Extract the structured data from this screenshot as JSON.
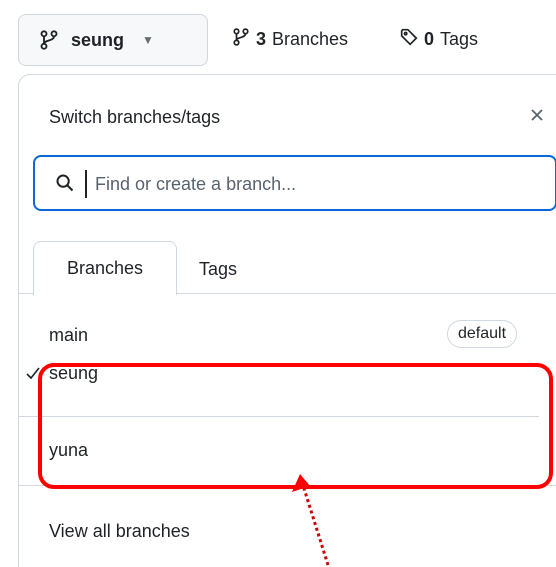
{
  "top_bar": {
    "current_branch": "seung",
    "branch_count_number": "3",
    "branch_count_label": "Branches",
    "tags_count_number": "0",
    "tags_count_label": "Tags"
  },
  "panel": {
    "title": "Switch branches/tags",
    "search_placeholder": "Find or create a branch...",
    "tabs": [
      {
        "label": "Branches",
        "active": true
      },
      {
        "label": "Tags",
        "active": false
      }
    ],
    "branches": [
      {
        "name": "main",
        "badge": "default",
        "selected": false
      },
      {
        "name": "seung",
        "badge": "",
        "selected": true
      },
      {
        "name": "yuna",
        "badge": "",
        "selected": false
      }
    ],
    "footer_link": "View all branches"
  },
  "colors": {
    "accent": "#0969da",
    "highlight": "#ff0000",
    "border": "#d0d7de",
    "text": "#1f2328"
  },
  "icons": {
    "branch": "git-branch-icon",
    "caret": "caret-down-icon",
    "tag": "tag-icon",
    "close": "close-icon",
    "search": "search-icon",
    "check": "check-icon"
  }
}
